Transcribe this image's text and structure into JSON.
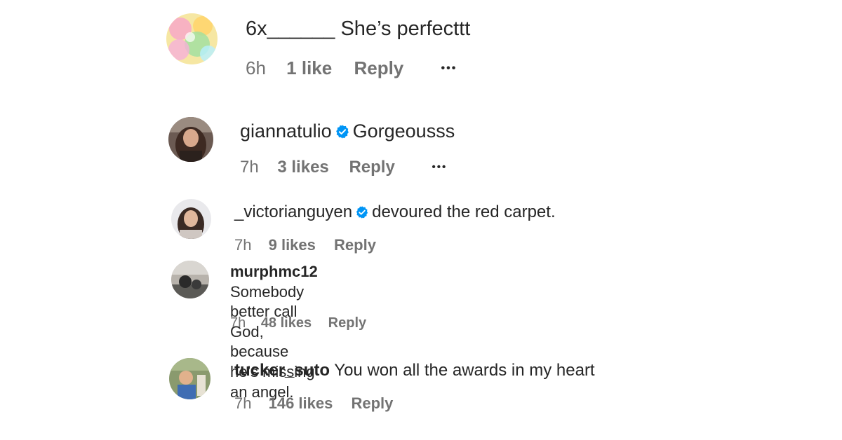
{
  "comments": [
    {
      "username": "6x______",
      "text": "She’s perfecttt",
      "time": "6h",
      "likes": "1 like",
      "reply": "Reply",
      "more": "•••",
      "verified": false
    },
    {
      "username": "giannatulio",
      "text": "Gorgeousss",
      "time": "7h",
      "likes": "3 likes",
      "reply": "Reply",
      "more": "•••",
      "verified": true
    },
    {
      "username": "_victorianguyen",
      "text": "devoured the red carpet.",
      "time": "7h",
      "likes": "9 likes",
      "reply": "Reply",
      "verified": true
    },
    {
      "username": "murphmc12",
      "text_line1": "Somebody better call God, because he’s missing",
      "text_line2": "an angel.",
      "time": "7h",
      "likes": "48 likes",
      "reply": "Reply",
      "verified": false
    },
    {
      "username": "tucker_suto",
      "text": "You won all the awards in my heart",
      "time": "7h",
      "likes": "146 likes",
      "reply": "Reply",
      "verified": false
    }
  ],
  "colors": {
    "verified_badge": "#0095f6",
    "meta_text": "#737373",
    "primary_text": "#262626"
  }
}
